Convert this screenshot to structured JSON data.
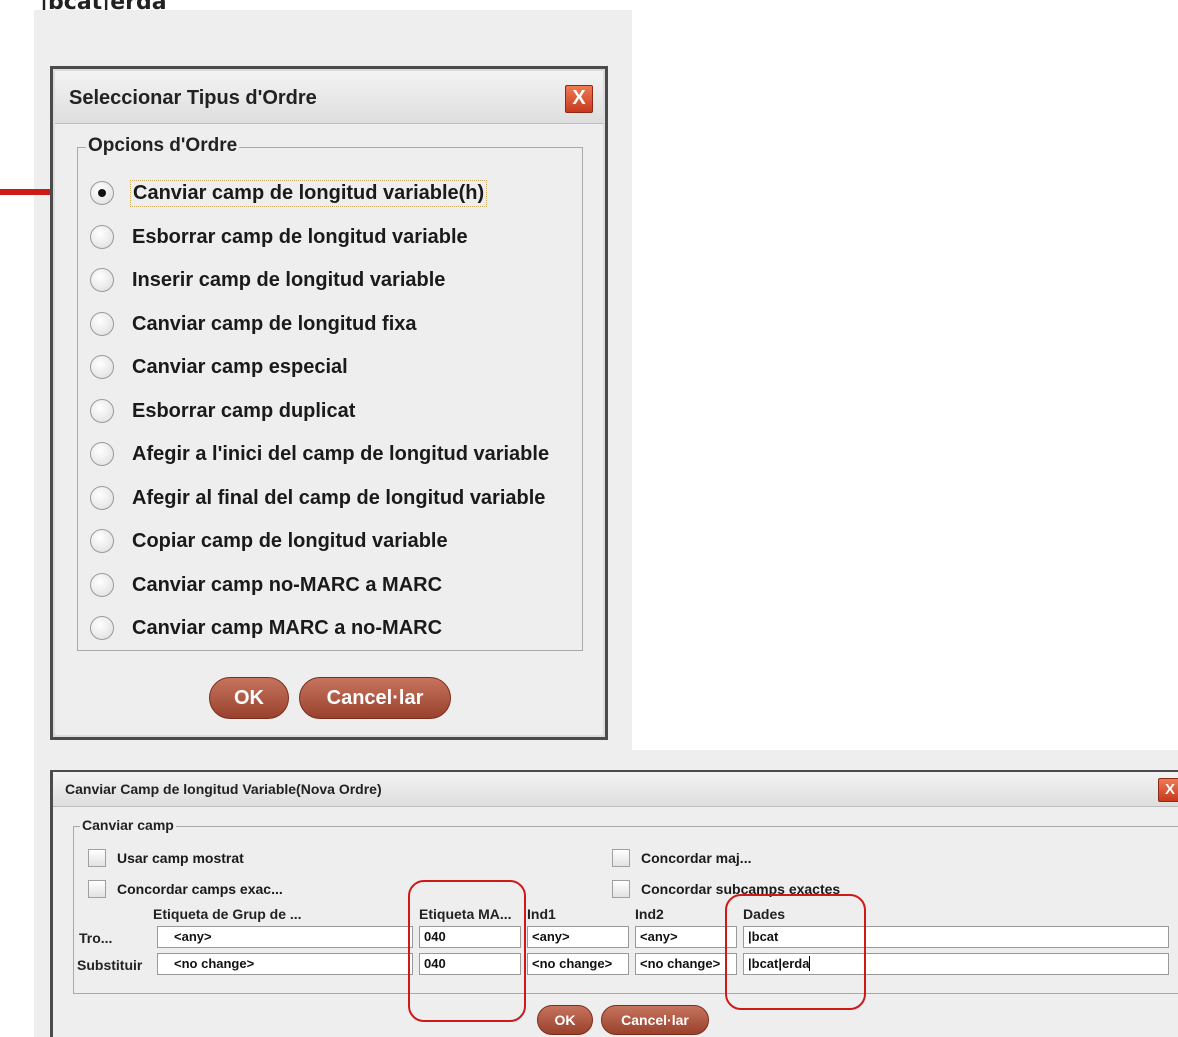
{
  "top_text": "|bcat|erda ",
  "dialog1": {
    "title": "Seleccionar Tipus d'Ordre",
    "close_label": "X",
    "group_legend": "Opcions d'Ordre",
    "options": [
      {
        "label": "Canviar camp de longitud variable(h)",
        "selected": true
      },
      {
        "label": "Esborrar camp de longitud variable",
        "selected": false
      },
      {
        "label": "Inserir camp de longitud variable",
        "selected": false
      },
      {
        "label": "Canviar camp de longitud fixa",
        "selected": false
      },
      {
        "label": "Canviar camp especial",
        "selected": false
      },
      {
        "label": "Esborrar camp duplicat",
        "selected": false
      },
      {
        "label": "Afegir a l'inici del camp de longitud variable",
        "selected": false
      },
      {
        "label": "Afegir al final del camp de longitud variable",
        "selected": false
      },
      {
        "label": "Copiar camp de longitud variable",
        "selected": false
      },
      {
        "label": "Canviar camp no-MARC a MARC",
        "selected": false
      },
      {
        "label": "Canviar camp MARC a no-MARC",
        "selected": false
      }
    ],
    "ok_label": "OK",
    "cancel_label": "Cancel·lar"
  },
  "dialog2": {
    "title": "Canviar Camp de longitud Variable(Nova Ordre)",
    "close_label": "X",
    "group_legend": "Canviar camp",
    "checkboxes": {
      "use_displayed": "Usar camp mostrat",
      "match_case": "Concordar maj...",
      "match_exact_fields": "Concordar camps exac...",
      "match_exact_subfields": "Concordar subcamps exactes"
    },
    "columns": {
      "group_tag": "Etiqueta de Grup de ...",
      "marc_tag": "Etiqueta MA...",
      "ind1": "Ind1",
      "ind2": "Ind2",
      "data": "Dades"
    },
    "rows": {
      "find": {
        "label": "Tro...",
        "group_tag": "<any>",
        "marc_tag": "040",
        "ind1": "<any>",
        "ind2": "<any>",
        "data": "|bcat"
      },
      "replace": {
        "label": "Substituir",
        "group_tag": "<no change>",
        "marc_tag": "040",
        "ind1": "<no change>",
        "ind2": "<no change>",
        "data": "|bcat|erda"
      }
    },
    "ok_label": "OK",
    "cancel_label": "Cancel·lar"
  },
  "annotation_color": "#cc1a1a",
  "button_color": "#b0533d"
}
